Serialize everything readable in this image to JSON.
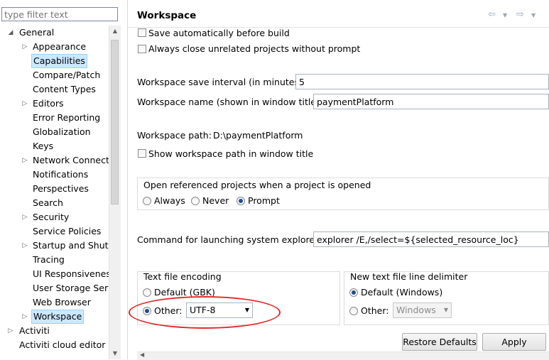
{
  "filter": {
    "placeholder": "type filter text"
  },
  "tree": {
    "general": "General",
    "items": [
      "Appearance",
      "Capabilities",
      "Compare/Patch",
      "Content Types",
      "Editors",
      "Error Reporting",
      "Globalization",
      "Keys",
      "Network Connectio",
      "Notifications",
      "Perspectives",
      "Search",
      "Security",
      "Service Policies",
      "Startup and Shutd",
      "Tracing",
      "UI Responsiveness",
      "User Storage Serv",
      "Web Browser",
      "Workspace"
    ],
    "activiti": "Activiti",
    "activiti_cloud": "Activiti cloud editor"
  },
  "page": {
    "title": "Workspace",
    "save_auto": "Save automatically before build",
    "always_close": "Always close unrelated projects without prompt",
    "save_interval_label": "Workspace save interval (in minutes):",
    "save_interval_value": "5",
    "ws_name_label": "Workspace name (shown in window title):",
    "ws_name_value": "paymentPlatform",
    "ws_path_label": "Workspace path:",
    "ws_path_value": "D:\\paymentPlatform",
    "show_path": "Show workspace path in window title",
    "open_ref_label": "Open referenced projects when a project is opened",
    "open_ref_always": "Always",
    "open_ref_never": "Never",
    "open_ref_prompt": "Prompt",
    "explorer_label": "Command for launching system explorer:",
    "explorer_value": "explorer /E,/select=${selected_resource_loc}",
    "encoding_label": "Text file encoding",
    "encoding_default": "Default (GBK)",
    "encoding_other": "Other:",
    "encoding_value": "UTF-8",
    "delimiter_label": "New text file line delimiter",
    "delimiter_default": "Default (Windows)",
    "delimiter_other": "Other:",
    "delimiter_value": "Windows",
    "restore_defaults": "Restore Defaults",
    "apply": "Apply"
  },
  "colors": {
    "selection": "#cce8ff",
    "annotation": "#e32b2b"
  }
}
